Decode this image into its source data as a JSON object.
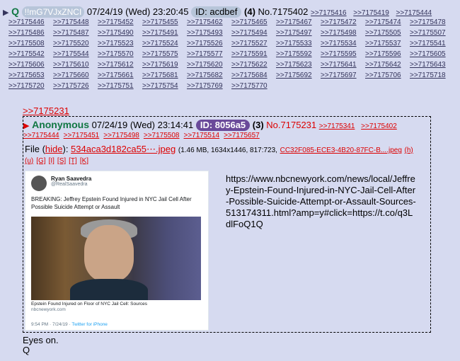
{
  "post": {
    "arrow": "▶",
    "name": "Q",
    "tripcode": "!!mG7VJxZNCI",
    "date": "07/24/19 (Wed) 23:20:45",
    "id_label": "ID: acdbef",
    "reply_count": "(4)",
    "post_number": "No.7175402",
    "header_replies": [
      ">>7175416",
      ">>7175419",
      ">>7175444"
    ],
    "replies": [
      ">>7175446",
      ">>7175448",
      ">>7175452",
      ">>7175455",
      ">>7175462",
      ">>7175465",
      ">>7175467",
      ">>7175472",
      ">>7175474",
      ">>7175478",
      ">>7175486",
      ">>7175487",
      ">>7175490",
      ">>7175491",
      ">>7175493",
      ">>7175494",
      ">>7175497",
      ">>7175498",
      ">>7175505",
      ">>7175507",
      ">>7175508",
      ">>7175520",
      ">>7175523",
      ">>7175524",
      ">>7175526",
      ">>7175527",
      ">>7175533",
      ">>7175534",
      ">>7175537",
      ">>7175541",
      ">>7175542",
      ">>7175544",
      ">>7175570",
      ">>7175575",
      ">>7175577",
      ">>7175591",
      ">>7175592",
      ">>7175595",
      ">>7175596",
      ">>7175605",
      ">>7175606",
      ">>7175610",
      ">>7175612",
      ">>7175619",
      ">>7175620",
      ">>7175622",
      ">>7175623",
      ">>7175641",
      ">>7175642",
      ">>7175643",
      ">>7175653",
      ">>7175660",
      ">>7175661",
      ">>7175681",
      ">>7175682",
      ">>7175684",
      ">>7175692",
      ">>7175697",
      ">>7175706",
      ">>7175718",
      ">>7175720",
      ">>7175726",
      ">>7175751",
      ">>7175754",
      ">>7175769",
      ">>7175770"
    ],
    "quote_link": ">>7175231",
    "body_lines": [
      "Eyes on.",
      "Q"
    ]
  },
  "quoted": {
    "arrow": "▶",
    "name": "Anonymous",
    "date": "07/24/19 (Wed) 23:14:41",
    "id_label": "ID: 8056a5",
    "reply_count": "(3)",
    "post_number": "No.7175231",
    "header_replies": [
      ">>7175341",
      ">>7175402"
    ],
    "replies": [
      ">>7175444",
      ">>7175451",
      ">>7175498",
      ">>7175508",
      ">>7175514",
      ">>7175657"
    ],
    "file_label": "File",
    "hide_label": "hide",
    "file_name": "534aca3d182ca55⋯.jpeg",
    "file_meta": "(1.46 MB, 1634x1446, 817:723,",
    "file_orig": "CC32F085-ECE3-4B20-87FC-B....jpeg",
    "file_h": "(h)",
    "file_actions": [
      "(u)",
      "[G]",
      "[I]",
      "[S]",
      "[T]",
      "[K]"
    ],
    "url_text": "https://www.nbcnewyork.com/news/local/Jeffrey-Epstein-Found-Injured-in-NYC-Jail-Cell-After-Possible-Suicide-Attempt-or-Assault-Sources-513174311.html?amp=y#click=https://t.co/q3LdlFoQ1Q",
    "tweet": {
      "name": "Ryan Saavedra",
      "handle": "@RealSaavedra",
      "text": "BREAKING: Jeffrey Epstein Found Injured in NYC Jail Cell After Possible Suicide Attempt or Assault",
      "caption": "Epstein Found Injured on Floor of NYC Jail Cell: Sources",
      "source": "nbcnewyork.com",
      "time": "9:54 PM · 7/24/19 ·",
      "client": "Twitter for iPhone"
    }
  },
  "colors": {
    "background": "#d6daf0",
    "name_green": "#117743",
    "link_red": "#dd0000",
    "link_blue": "#34345c",
    "id_badge_purple": "#6a4a9a"
  }
}
